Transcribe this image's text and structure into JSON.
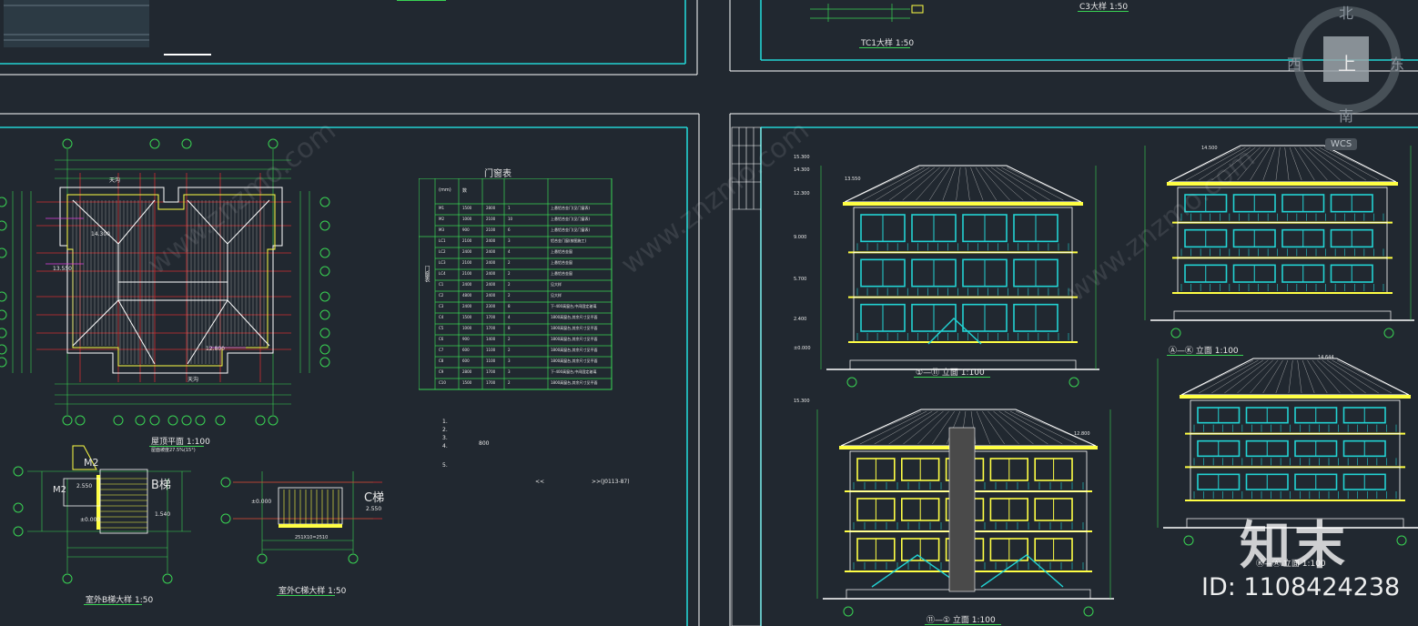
{
  "drawing_titles": {
    "tc1_detail": "TC1大样  1:50",
    "c3_detail": "C3大样  1:50",
    "roof_plan": "屋顶平面  1:100",
    "roof_plan_note": "屋面坡度27.5%(15°)",
    "stair_b_detail": "室外B梯大样  1:50",
    "stair_c_detail": "室外C梯大样  1:50",
    "door_window_table": "门窗表",
    "elevation_1_11": "①—⑪  立面  1:100",
    "elevation_a_k": "Ⓐ—Ⓚ  立面  1:100",
    "elevation_11_1": "⑪—①  立面  1:100",
    "elevation_k_a": "Ⓚ—Ⓐ  立面  1:100"
  },
  "plan_labels": {
    "top_axes": [
      "1",
      "5",
      "7",
      "11"
    ],
    "bottom_axes": [
      "1",
      "2",
      "3",
      "4",
      "5",
      "6",
      "7",
      "8",
      "9",
      "10",
      "11"
    ],
    "left_axes": [
      "K",
      "J",
      "H",
      "G",
      "F",
      "E",
      "D",
      "C",
      "B",
      "A"
    ],
    "ridge_top": "天沟",
    "ridge_bottom": "天沟",
    "elev_a": "14.300",
    "elev_b": "13.550",
    "elev_c": "12.800",
    "stair_b_label": "B梯",
    "stair_c_label": "C梯",
    "stair_b_m2": "M2",
    "stair_b_elev1": "2.550",
    "stair_b_elev2": "±0.000",
    "stair_b_elev3": "1.540",
    "stair_c_elev": "2.550",
    "stair_c_elev2": "±0.000",
    "stair_c_dim": "251X10=2510"
  },
  "table": {
    "header": [
      "",
      "",
      "(mm)",
      "数",
      "",
      ""
    ],
    "side_label": "门窗表",
    "rows": [
      [
        "M1",
        "1500",
        "2800",
        "1",
        "上悬铝合金门(见门窗表)"
      ],
      [
        "M2",
        "1000",
        "2100",
        "10",
        "上悬铝合金门(见门窗表)"
      ],
      [
        "M3",
        "900",
        "2100",
        "6",
        "上悬铝合金门(见门窗表)"
      ],
      [
        "LC1",
        "2100",
        "2400",
        "3",
        "铝合金门窗(按图施工)"
      ],
      [
        "LC2",
        "2400",
        "2400",
        "4",
        "上悬铝合金窗"
      ],
      [
        "LC3",
        "2100",
        "2400",
        "2",
        "上悬铝合金窗"
      ],
      [
        "LC4",
        "2100",
        "2400",
        "2",
        "上悬铝合金窗"
      ],
      [
        "C1",
        "2400",
        "2400",
        "2",
        "见大样"
      ],
      [
        "C2",
        "4800",
        "2400",
        "2",
        "见大样"
      ],
      [
        "C3",
        "2400",
        "2300",
        "8",
        "下-400高窗台,中间固定玻璃"
      ],
      [
        "C4",
        "1500",
        "1700",
        "4",
        "1800高窗台,其余尺寸见平面"
      ],
      [
        "C5",
        "1000",
        "1700",
        "8",
        "1800高窗台,其余尺寸见平面"
      ],
      [
        "C6",
        "900",
        "1400",
        "2",
        "1800高窗台,其余尺寸见平面"
      ],
      [
        "C7",
        "600",
        "1100",
        "2",
        "1800高窗台,其余尺寸见平面"
      ],
      [
        "C8",
        "600",
        "1100",
        "3",
        "1800高窗台,其余尺寸见平面"
      ],
      [
        "C9",
        "2800",
        "1700",
        "3",
        "下-400高窗台,中间固定玻璃"
      ],
      [
        "C10",
        "1500",
        "1700",
        "2",
        "1800高窗台,其余尺寸见平面"
      ]
    ]
  },
  "notes": {
    "items": [
      "1.",
      "2.",
      "3.",
      "4.",
      "5."
    ],
    "value_800": "800",
    "ref_left": "<<",
    "ref_right": ">>(J0113-87)"
  },
  "elevation_marks": {
    "e1": "15.300",
    "e2": "14.300",
    "e3": "12.300",
    "e4": "9.000",
    "e5": "5.700",
    "e6": "2.400",
    "e7": "±0.000",
    "e8": "13.550",
    "e9": "14.500",
    "e10": "14.644",
    "e11": "12.800",
    "e12": "15.300"
  },
  "viewcube": {
    "north": "北",
    "south": "南",
    "east": "东",
    "west": "西",
    "face": "上",
    "wcs": "WCS"
  },
  "watermark": {
    "site": "www.znzmo.com",
    "brand": "知末",
    "image_id": "ID: 1108424238"
  }
}
